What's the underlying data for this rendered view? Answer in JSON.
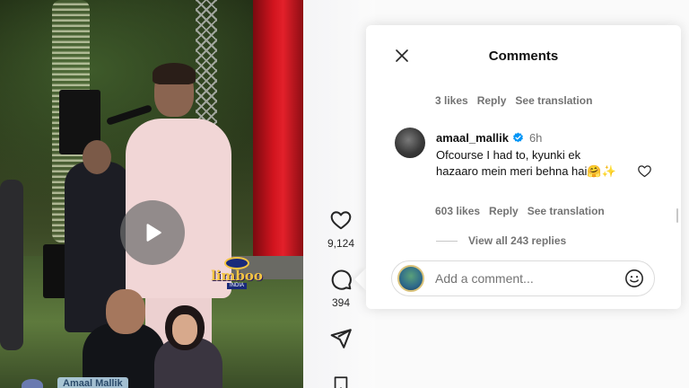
{
  "video": {
    "watermark": {
      "brand": "limboo",
      "sub": "INDIA"
    },
    "caption": "Amaal Mallik"
  },
  "actions": {
    "like_count": "9,124",
    "comment_count": "394"
  },
  "comments": {
    "title": "Comments",
    "prev_comment_meta": {
      "likes": "3 likes",
      "reply": "Reply",
      "translate": "See translation"
    },
    "comment": {
      "username": "amaal_mallik",
      "time": "6h",
      "text": "Ofcourse I had to, kyunki ek hazaaro mein meri behna hai🤗✨",
      "likes": "603 likes",
      "reply": "Reply",
      "translate": "See translation"
    },
    "view_replies": "View all 243 replies",
    "input_placeholder": "Add a comment..."
  },
  "colors": {
    "verified": "#0095f6",
    "muted_text": "#737373",
    "curtain_red": "#e3202a"
  }
}
